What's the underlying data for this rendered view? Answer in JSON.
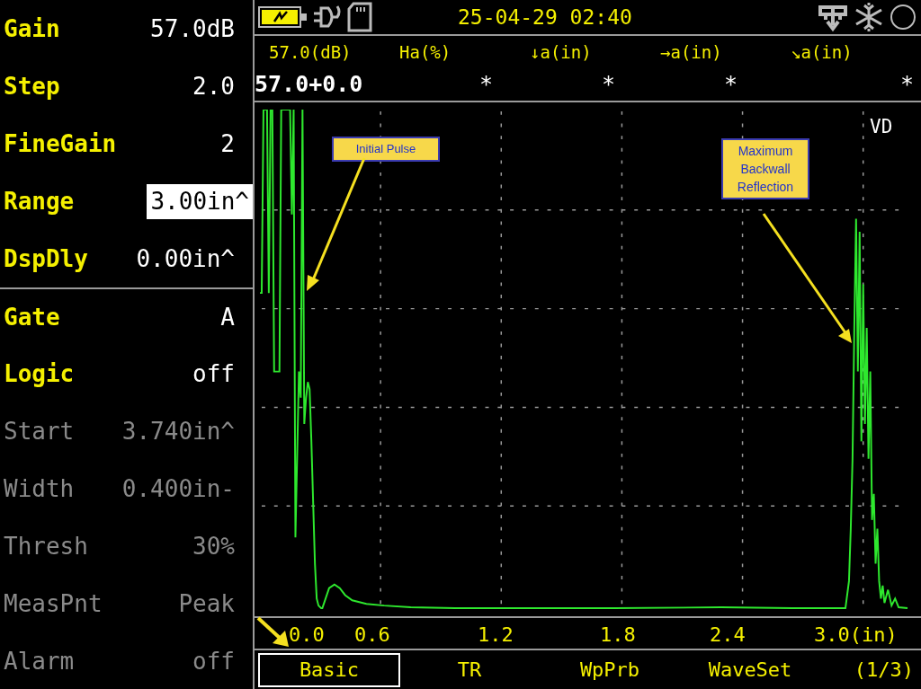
{
  "params": [
    {
      "label": "Gain",
      "value": "57.0dB",
      "enabled": true,
      "selected": false
    },
    {
      "label": "Step",
      "value": "2.0",
      "enabled": true,
      "selected": false
    },
    {
      "label": "FineGain",
      "value": "2",
      "enabled": true,
      "selected": false
    },
    {
      "label": "Range",
      "value": "3.00in^",
      "enabled": true,
      "selected": true
    },
    {
      "label": "DspDly",
      "value": "0.00in^",
      "enabled": true,
      "selected": false
    },
    {
      "label": "Gate",
      "value": "A",
      "enabled": true,
      "selected": false
    },
    {
      "label": "Logic",
      "value": "off",
      "enabled": true,
      "selected": false
    },
    {
      "label": "Start",
      "value": "3.740in^",
      "enabled": false,
      "selected": false
    },
    {
      "label": "Width",
      "value": "0.400in-",
      "enabled": false,
      "selected": false
    },
    {
      "label": "Thresh",
      "value": "30%",
      "enabled": false,
      "selected": false
    },
    {
      "label": "MeasPnt",
      "value": "Peak",
      "enabled": false,
      "selected": false
    },
    {
      "label": "Alarm",
      "value": "off",
      "enabled": false,
      "selected": false
    }
  ],
  "status_bar": {
    "datetime": "25-04-29 02:40"
  },
  "readings": {
    "labels": [
      "57.0(dB)",
      "Ha(%)",
      "↓a(in)",
      "→a(in)",
      "↘a(in)"
    ],
    "values": [
      "57.0+0.0",
      "*",
      "*",
      "*",
      "*"
    ]
  },
  "plot": {
    "mode": "VD",
    "x_ticks": [
      "0.0",
      "0.6",
      "1.2",
      "1.8",
      "2.4",
      "3.0(in)"
    ],
    "callouts": [
      {
        "text": "Initial Pulse"
      },
      {
        "text": "Maximum Backwall Reflection"
      }
    ]
  },
  "tabs": [
    {
      "label": "Basic",
      "selected": true
    },
    {
      "label": "TR",
      "selected": false
    },
    {
      "label": "WpPrb",
      "selected": false
    },
    {
      "label": "WaveSet",
      "selected": false
    }
  ],
  "page_indicator": "(1/3)"
}
